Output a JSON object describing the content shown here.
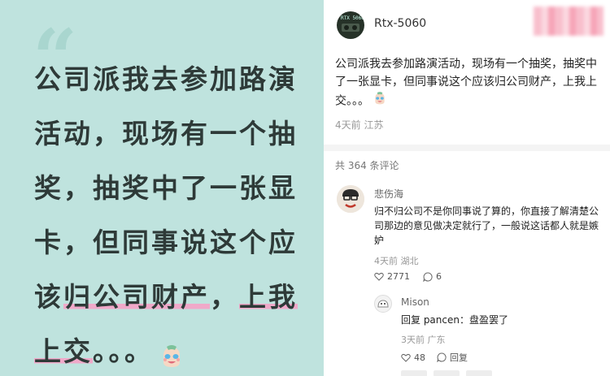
{
  "quote_card": {
    "quote_mark": "“",
    "lines": [
      "公司派我去参加路演",
      "活动，现场有一个抽",
      "奖，抽奖中了一张显",
      "卡，但同事说这个应"
    ],
    "line5_pre": "该",
    "line5_hl": "归公司财产",
    "line5_mid": "，",
    "line5_hl2": "上我",
    "line6_hl": "上交",
    "line6_post": "。。。",
    "emoji": "crying-face-emoji",
    "colors": {
      "background": "#bfe3de",
      "highlight": "#f0a9c9",
      "text": "#2e3a38"
    }
  },
  "post": {
    "username": "Rtx-5060",
    "avatar_text": "RTX 5060",
    "text": "公司派我去参加路演活动，现场有一个抽奖，抽奖中了一张显卡，但同事说这个应该归公司财产，上我上交。。。",
    "meta": "4天前 江苏"
  },
  "comments_header": "共 364 条评论",
  "comments": [
    {
      "name": "悲伤海",
      "body": "归不归公司不是你同事说了算的，你直接了解清楚公司那边的意见做决定就行了，一般说这话都人就是嫉妒",
      "meta": "4天前 湖北",
      "likes": "2771",
      "replies": "6"
    }
  ],
  "reply": {
    "name": "Mison",
    "body": "回复 pancen：盘盈罢了",
    "meta": "3天前 广东",
    "likes": "48",
    "reply_label": "回复"
  }
}
